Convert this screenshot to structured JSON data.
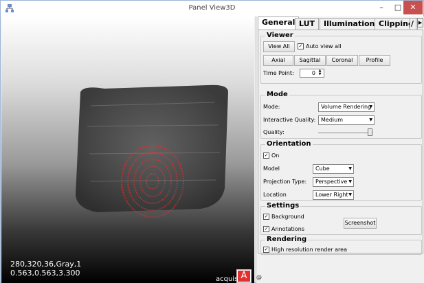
{
  "window": {
    "title": "Panel View3D",
    "minimize": "–",
    "maximize": "□",
    "close": "✕",
    "app_icon": "network-icon"
  },
  "viewport": {
    "overlay_line1": "280,320,36,Gray,1",
    "overlay_line2": "0.563,0.563,3.300",
    "acquisition_label": "acquisi",
    "acquisition_icon_label": "A"
  },
  "tabs": [
    "General",
    "LUT",
    "Illumination",
    "Clipping",
    "/"
  ],
  "viewer": {
    "title": "Viewer",
    "view_all": "View All",
    "auto_view_all": "Auto view all",
    "axial": "Axial",
    "sagittal": "Sagittal",
    "coronal": "Coronal",
    "profile": "Profile",
    "time_point_label": "Time Point:",
    "time_point_value": "0"
  },
  "mode": {
    "title": "Mode",
    "mode_label": "Mode:",
    "mode_value": "Volume Rendering",
    "quality_label": "Interactive Quality:",
    "quality_value": "Medium",
    "slider_label": "Quality:",
    "slider_level": 0.95
  },
  "orientation": {
    "title": "Orientation",
    "on_label": "On",
    "model_label": "Model",
    "model_value": "Cube",
    "projection_label": "Projection Type:",
    "projection_value": "Perspective",
    "location_label": "Location",
    "location_value": "Lower Right"
  },
  "settings": {
    "title": "Settings",
    "background": "Background",
    "annotations": "Annotations",
    "screenshot": "Screenshot"
  },
  "rendering": {
    "title": "Rendering",
    "high_res": "High resolution render area"
  },
  "status": {
    "text": "@"
  },
  "colors": {
    "close_button": "#c75050",
    "highlight": "#e03030"
  }
}
